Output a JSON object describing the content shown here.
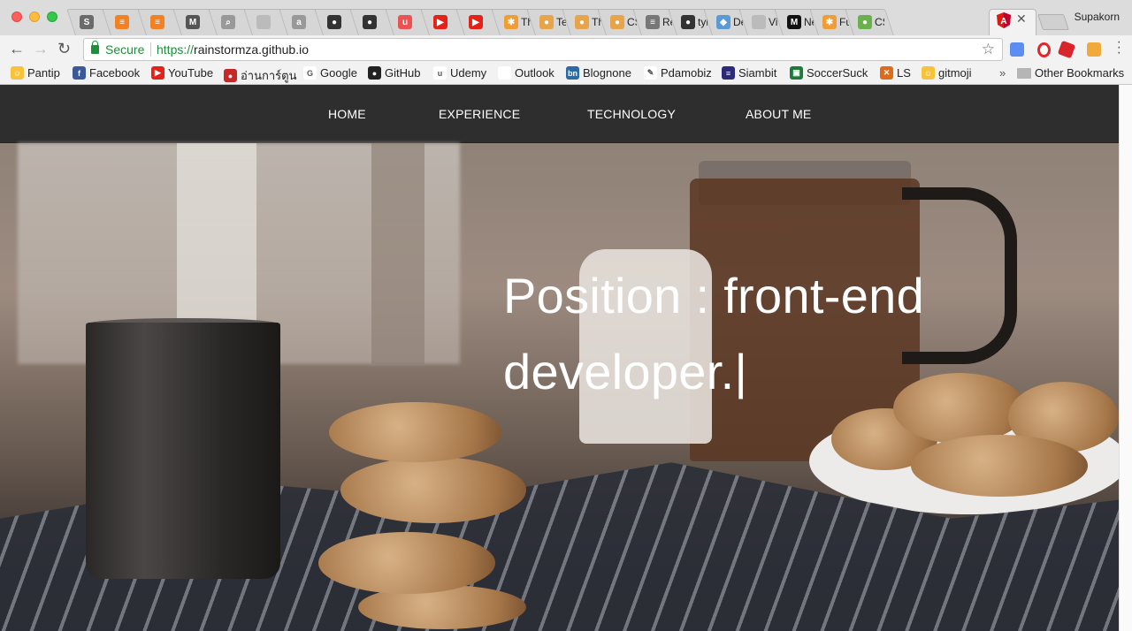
{
  "browser": {
    "tabs": [
      {
        "title": "",
        "favicon": "s-favicon",
        "color": "#6b6b6b",
        "glyph": "S"
      },
      {
        "title": "",
        "favicon": "stackoverflow-icon",
        "color": "#f48024",
        "glyph": "≡"
      },
      {
        "title": "",
        "favicon": "stackoverflow-icon",
        "color": "#f48024",
        "glyph": "≡"
      },
      {
        "title": "",
        "favicon": "medium-icon",
        "color": "#555555",
        "glyph": "M"
      },
      {
        "title": "",
        "favicon": "search-icon",
        "color": "#999999",
        "glyph": "⌕"
      },
      {
        "title": "",
        "favicon": "page-icon",
        "color": "#bbbbbb",
        "glyph": ""
      },
      {
        "title": "",
        "favicon": "a-icon",
        "color": "#999999",
        "glyph": "a"
      },
      {
        "title": "",
        "favicon": "github-icon",
        "color": "#333333",
        "glyph": "●"
      },
      {
        "title": "",
        "favicon": "github-icon",
        "color": "#333333",
        "glyph": "●"
      },
      {
        "title": "",
        "favicon": "udemy-icon",
        "color": "#ec5252",
        "glyph": "u"
      },
      {
        "title": "",
        "favicon": "youtube-icon",
        "color": "#e62117",
        "glyph": "▶"
      },
      {
        "title": "",
        "favicon": "youtube-icon",
        "color": "#e62117",
        "glyph": "▶"
      },
      {
        "title": "Th",
        "favicon": "star-icon",
        "color": "#f09d36",
        "glyph": "✱"
      },
      {
        "title": "Te",
        "favicon": "coin-icon",
        "color": "#e8a44a",
        "glyph": "●"
      },
      {
        "title": "Th",
        "favicon": "coin-icon",
        "color": "#e8a44a",
        "glyph": "●"
      },
      {
        "title": "CS",
        "favicon": "coin-icon",
        "color": "#e8a44a",
        "glyph": "●"
      },
      {
        "title": "Re",
        "favicon": "list-icon",
        "color": "#777777",
        "glyph": "≡"
      },
      {
        "title": "tyl",
        "favicon": "github-icon",
        "color": "#333333",
        "glyph": "●"
      },
      {
        "title": "De",
        "favicon": "diamond-icon",
        "color": "#5a9bd5",
        "glyph": "◆"
      },
      {
        "title": "Vi",
        "favicon": "page-icon",
        "color": "#bbbbbb",
        "glyph": ""
      },
      {
        "title": "Ne",
        "favicon": "medium-icon",
        "color": "#111111",
        "glyph": "M"
      },
      {
        "title": "Fu",
        "favicon": "star-icon",
        "color": "#f09d36",
        "glyph": "✱"
      },
      {
        "title": "CS",
        "favicon": "leaf-icon",
        "color": "#6ab04c",
        "glyph": "●"
      }
    ],
    "active_tab": {
      "favicon": "angular-icon",
      "color": "#dd1b16"
    },
    "profile_name": "Supakorn",
    "secure_label": "Secure",
    "url_scheme": "https://",
    "url_host": "rainstormza.github.io",
    "bookmarks": [
      {
        "label": "Pantip",
        "icon": "pantip-icon",
        "color": "#f6c33b",
        "glyph": "☺"
      },
      {
        "label": "Facebook",
        "icon": "facebook-icon",
        "color": "#3b5998",
        "glyph": "f"
      },
      {
        "label": "YouTube",
        "icon": "youtube-icon",
        "color": "#e62117",
        "glyph": "▶"
      },
      {
        "label": "อ่านการ์ตูน",
        "icon": "manga-icon",
        "color": "#c62828",
        "glyph": "●"
      },
      {
        "label": "Google",
        "icon": "google-icon",
        "color": "#ffffff",
        "glyph": "G"
      },
      {
        "label": "GitHub",
        "icon": "github-icon",
        "color": "#222222",
        "glyph": "●"
      },
      {
        "label": "Udemy",
        "icon": "udemy-icon",
        "color": "#ffffff",
        "glyph": "u"
      },
      {
        "label": "Outlook",
        "icon": "page-icon",
        "color": "#ffffff",
        "glyph": ""
      },
      {
        "label": "Blognone",
        "icon": "blognone-icon",
        "color": "#2d6aa3",
        "glyph": "bn"
      },
      {
        "label": "Pdamobiz",
        "icon": "pdamobiz-icon",
        "color": "#ffffff",
        "glyph": "✎"
      },
      {
        "label": "Siambit",
        "icon": "thai-flag-icon",
        "color": "#2d2a7a",
        "glyph": "≡"
      },
      {
        "label": "SoccerSuck",
        "icon": "soccersuck-icon",
        "color": "#1e7a3c",
        "glyph": "▣"
      },
      {
        "label": "LS",
        "icon": "ls-icon",
        "color": "#e06a1b",
        "glyph": "✕"
      },
      {
        "label": "gitmoji",
        "icon": "gitmoji-icon",
        "color": "#f6c33b",
        "glyph": "☺"
      }
    ],
    "other_bookmarks": "Other Bookmarks"
  },
  "site": {
    "nav": [
      "HOME",
      "EXPERIENCE",
      "TECHNOLOGY",
      "ABOUT ME"
    ],
    "headline_line1": "Position : front-end",
    "headline_line2": "developer.|"
  }
}
